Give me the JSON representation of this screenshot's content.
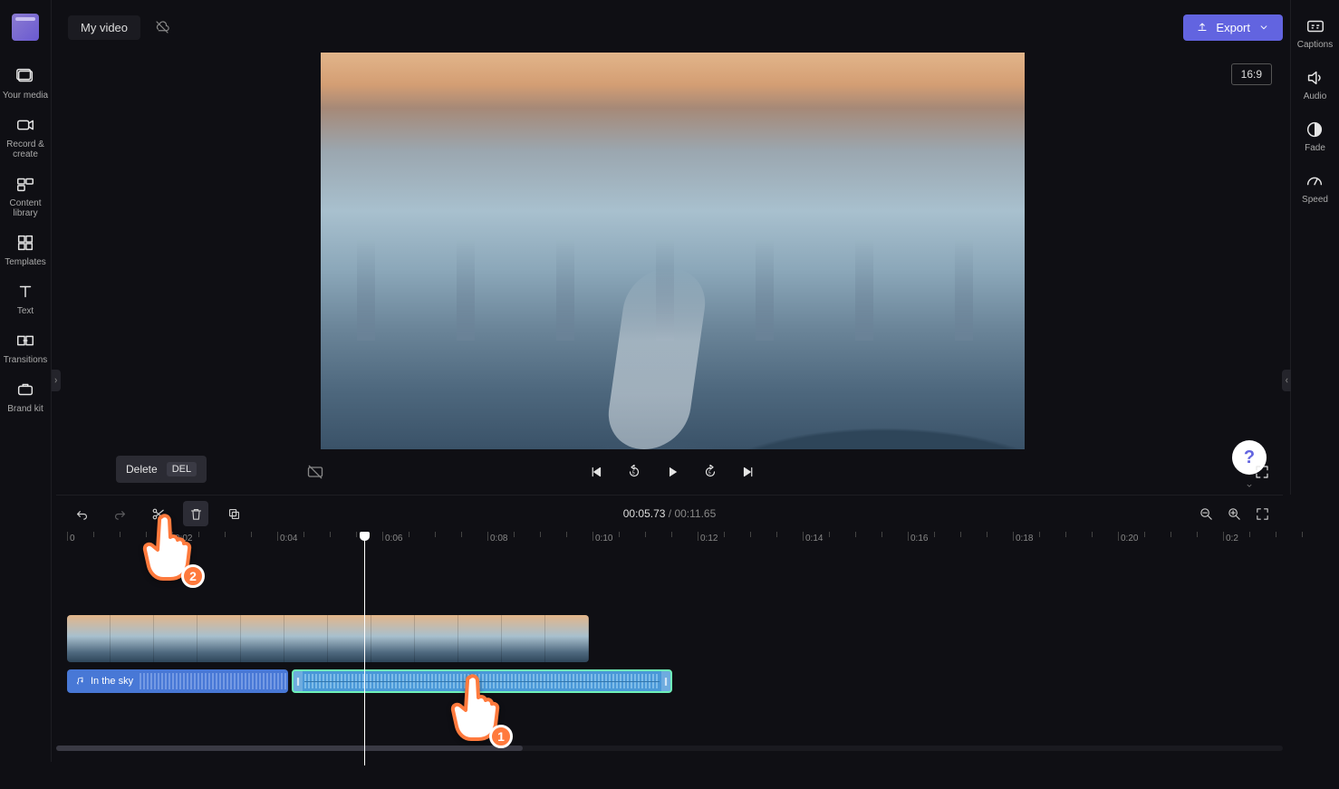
{
  "header": {
    "project_title": "My video",
    "export_label": "Export",
    "aspect_ratio": "16:9"
  },
  "left_nav": {
    "your_media": "Your media",
    "record_create": "Record & create",
    "content_library": "Content library",
    "templates": "Templates",
    "text": "Text",
    "transitions": "Transitions",
    "brand_kit": "Brand kit"
  },
  "right_nav": {
    "captions": "Captions",
    "audio": "Audio",
    "fade": "Fade",
    "speed": "Speed"
  },
  "tooltip": {
    "label": "Delete",
    "kbd": "DEL"
  },
  "player_time": {
    "current": "00:05.73",
    "separator": " / ",
    "duration": "00:11.65"
  },
  "ruler": {
    "labels": [
      "0",
      "0:02",
      "0:04",
      "0:06",
      "0:08",
      "0:10",
      "0:12",
      "0:14",
      "0:16",
      "0:18",
      "0:20",
      "0:2"
    ]
  },
  "tracks": {
    "audio1_label": "In the sky"
  },
  "overlays": {
    "hand1_num": "1",
    "hand2_num": "2"
  },
  "help": {
    "glyph": "?"
  }
}
